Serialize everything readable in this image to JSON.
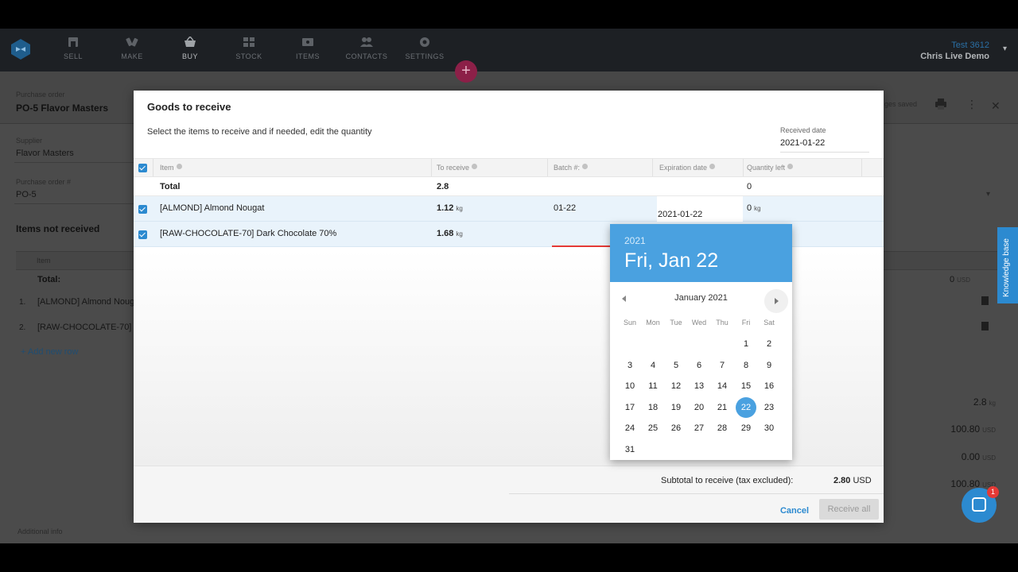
{
  "nav": {
    "items": [
      {
        "label": "SELL"
      },
      {
        "label": "MAKE"
      },
      {
        "label": "BUY"
      },
      {
        "label": "STOCK"
      },
      {
        "label": "ITEMS"
      },
      {
        "label": "CONTACTS"
      },
      {
        "label": "SETTINGS"
      }
    ],
    "active": "BUY",
    "account": "Test 3612",
    "user": "Chris Live Demo",
    "plus": "+"
  },
  "po": {
    "type_label": "Purchase order",
    "title": "PO-5 Flavor Masters",
    "saved_text": "ges saved",
    "supplier_label": "Supplier",
    "supplier": "Flavor Masters",
    "po_number_label": "Purchase order #",
    "po_number": "PO-5",
    "items_section_title": "Items not received",
    "items_header_item": "Item",
    "total_label": "Total:",
    "total_value": "0",
    "total_unit": "USD",
    "rows": [
      {
        "num": "1.",
        "name": "[ALMOND] Almond Noug"
      },
      {
        "num": "2.",
        "name": "[RAW-CHOCOLATE-70] Da"
      }
    ],
    "add_row": "+ Add new row",
    "summary": [
      {
        "value": "2.8",
        "unit": "kg"
      },
      {
        "value": "100.80",
        "unit": "USD"
      },
      {
        "value": "0.00",
        "unit": "USD"
      },
      {
        "value": "100.80",
        "unit": "USD"
      }
    ],
    "additional_info_label": "Additional info"
  },
  "knowledge_base": "Knowledge base",
  "chat_badge": "1",
  "modal": {
    "title": "Goods to receive",
    "subtitle": "Select the items to receive and if needed, edit the quantity",
    "received_date_label": "Received date",
    "received_date": "2021-01-22",
    "columns": {
      "item": "Item",
      "to_receive": "To receive",
      "batch": "Batch #:",
      "expiration": "Expiration date",
      "qty_left": "Quantity left"
    },
    "total": {
      "label": "Total",
      "to_receive": "2.8",
      "qty_left": "0"
    },
    "rows": [
      {
        "item": "[ALMOND] Almond Nougat",
        "to_receive": "1.12",
        "unit": "kg",
        "batch": "01-22",
        "expiration": "2021-01-22",
        "qty_left": "0",
        "qty_unit": "kg"
      },
      {
        "item": "[RAW-CHOCOLATE-70] Dark Chocolate 70%",
        "to_receive": "1.68",
        "unit": "kg",
        "batch": "",
        "expiration": "",
        "qty_left": "",
        "qty_unit": ""
      }
    ],
    "subtotal_label": "Subtotal to receive (tax excluded):",
    "subtotal_value": "2.80",
    "subtotal_unit": "USD",
    "cancel": "Cancel",
    "receive_all": "Receive all"
  },
  "datepicker": {
    "year": "2021",
    "date_display": "Fri, Jan 22",
    "month_label": "January 2021",
    "weekdays": [
      "Sun",
      "Mon",
      "Tue",
      "Wed",
      "Thu",
      "Fri",
      "Sat"
    ],
    "first_weekday_index": 5,
    "days_in_month": 31,
    "selected_day": 22
  }
}
